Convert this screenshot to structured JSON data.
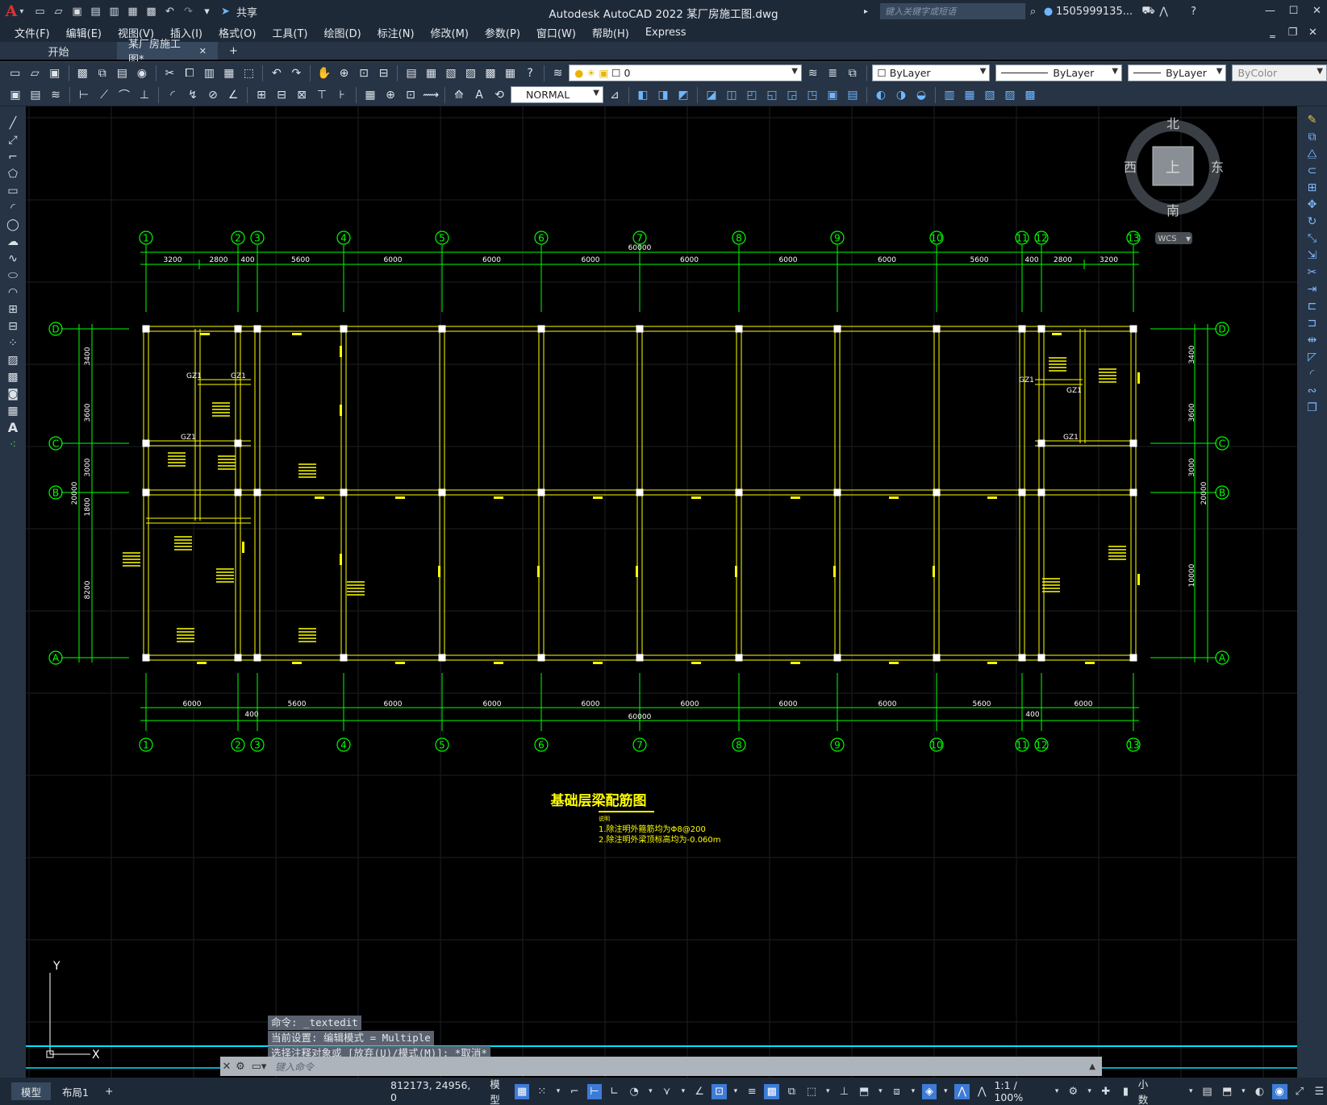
{
  "app": {
    "title": "Autodesk AutoCAD 2022    某厂房施工图.dwg",
    "share_label": "共享",
    "search_placeholder": "键入关键字或短语",
    "user_name": "1505999135..."
  },
  "menu": [
    "文件(F)",
    "编辑(E)",
    "视图(V)",
    "插入(I)",
    "格式(O)",
    "工具(T)",
    "绘图(D)",
    "标注(N)",
    "修改(M)",
    "参数(P)",
    "窗口(W)",
    "帮助(H)",
    "Express"
  ],
  "tabs": {
    "start": "开始",
    "doc": "某厂房施工图*",
    "close": "✕",
    "add": "+"
  },
  "toolbar": {
    "layer": "0",
    "color": "ByLayer",
    "linetype": "ByLayer",
    "lineweight": "ByLayer",
    "plotstyle": "ByColor",
    "textstyle": "NORMAL"
  },
  "viewcube": {
    "north": "北",
    "south": "南",
    "east": "东",
    "west": "西",
    "top": "上",
    "wcs": "WCS"
  },
  "drawing": {
    "grid_top": [
      "1",
      "2",
      "3",
      "4",
      "5",
      "6",
      "7",
      "8",
      "9",
      "10",
      "11",
      "12",
      "13"
    ],
    "grid_bottom": [
      "1",
      "2",
      "3",
      "4",
      "5",
      "6",
      "7",
      "8",
      "9",
      "10",
      "11",
      "12",
      "13"
    ],
    "grid_left": [
      "D",
      "C",
      "B",
      "A"
    ],
    "grid_right": [
      "D",
      "C",
      "B",
      "A"
    ],
    "dims_top": [
      "3200",
      "2800",
      "400",
      "5600",
      "6000",
      "6000",
      "6000",
      "6000",
      "6000",
      "6000",
      "5600",
      "400",
      "2800",
      "3200"
    ],
    "dim_top_total": "60000",
    "dims_bottom": [
      "6000",
      "400",
      "5600",
      "6000",
      "6000",
      "6000",
      "6000",
      "6000",
      "6000",
      "5600",
      "400",
      "6000"
    ],
    "dim_bottom_total": "60000",
    "dims_left": [
      "3400",
      "3600",
      "3000",
      "1800",
      "8200"
    ],
    "dim_left_total": "20000",
    "dims_right": [
      "3400",
      "3600",
      "3000",
      "10000"
    ],
    "dim_right_total": "20000",
    "gz_labels": [
      "GZ1",
      "GZ1",
      "GZ1",
      "GZ1",
      "GZ1",
      "GZ1"
    ],
    "title": "基础层梁配筋图",
    "notes_heading": "说明",
    "notes": [
      "1.除注明外箍筋均为Φ8@200",
      "2.除注明外梁顶标高均为-0.060m"
    ],
    "ucs_x": "X",
    "ucs_y": "Y"
  },
  "command": {
    "history": [
      "命令: _textedit",
      "当前设置: 编辑模式 = Multiple",
      "选择注释对象或 [放弃(U)/模式(M)]: *取消*"
    ],
    "placeholder": "键入命令"
  },
  "status": {
    "model_tab": "模型",
    "layout_tab": "布局1",
    "add_tab": "+",
    "coords": "812173, 24956, 0",
    "model_label": "模型",
    "scale": "1:1 / 100%",
    "units": "小数"
  },
  "colors": {
    "grid": "#00ff00",
    "beam": "#ffff00",
    "column": "#ffffff",
    "accent": "#00e5ff"
  }
}
